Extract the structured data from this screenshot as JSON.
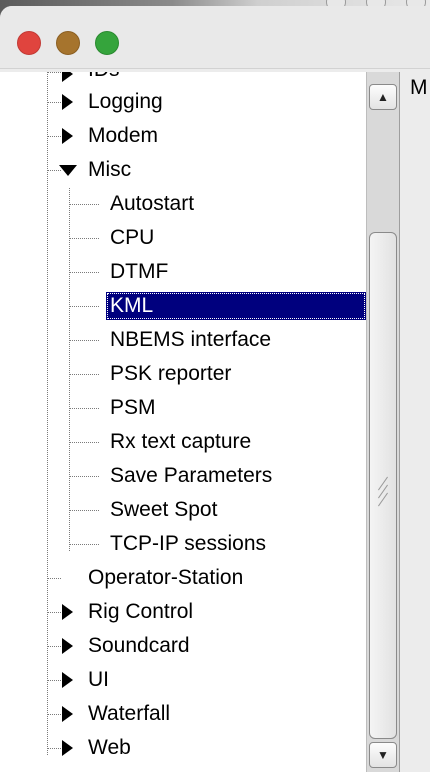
{
  "tree": {
    "top_partial_label": "IDs",
    "items": [
      {
        "label": "Logging",
        "expander": "collapsed"
      },
      {
        "label": "Modem",
        "expander": "collapsed"
      },
      {
        "label": "Misc",
        "expander": "expanded"
      },
      {
        "label": "Autostart"
      },
      {
        "label": "CPU"
      },
      {
        "label": "DTMF"
      },
      {
        "label": "KML",
        "selected": true
      },
      {
        "label": "NBEMS interface"
      },
      {
        "label": "PSK reporter"
      },
      {
        "label": "PSM"
      },
      {
        "label": "Rx text capture"
      },
      {
        "label": "Save Parameters"
      },
      {
        "label": "Sweet Spot"
      },
      {
        "label": "TCP-IP sessions"
      },
      {
        "label": "Operator-Station"
      },
      {
        "label": "Rig Control",
        "expander": "collapsed"
      },
      {
        "label": "Soundcard",
        "expander": "collapsed"
      },
      {
        "label": "UI",
        "expander": "collapsed"
      },
      {
        "label": "Waterfall",
        "expander": "collapsed"
      },
      {
        "label": "Web",
        "expander": "collapsed"
      }
    ]
  },
  "scrollbar": {
    "up_glyph": "▲",
    "down_glyph": "▼"
  },
  "right_panel": {
    "partial_text": "M"
  },
  "colors": {
    "selection": "#00007e",
    "close": "#e0443e",
    "minimize": "#a6742d",
    "zoom": "#35a43c"
  }
}
